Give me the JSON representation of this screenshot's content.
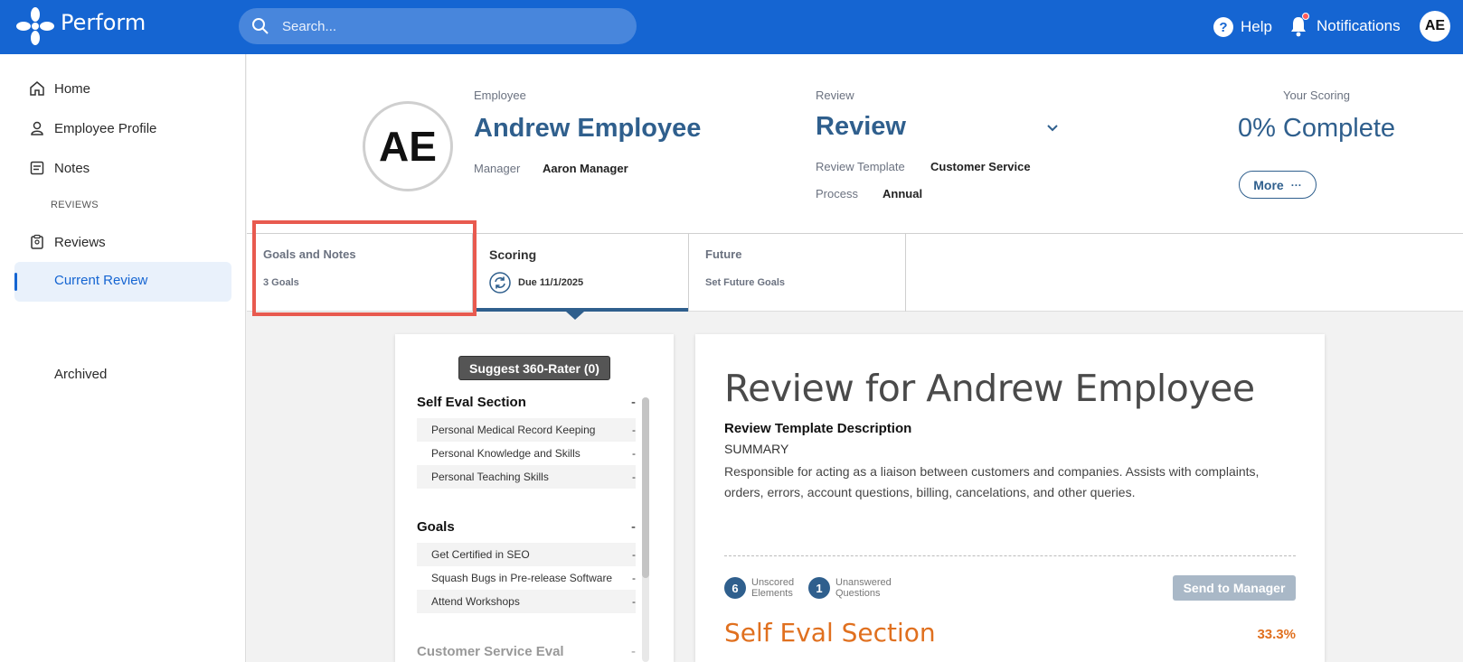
{
  "app": {
    "brand": "Perform",
    "search_placeholder": "Search...",
    "help_label": "Help",
    "notifications_label": "Notifications",
    "user_initials": "AE"
  },
  "sidebar": {
    "home": "Home",
    "employee_profile": "Employee Profile",
    "notes": "Notes",
    "section_label": "REVIEWS",
    "reviews": "Reviews",
    "current_review": "Current Review",
    "archived": "Archived"
  },
  "header": {
    "avatar_initials": "AE",
    "employee_label": "Employee",
    "employee_name": "Andrew Employee",
    "manager_label": "Manager",
    "manager_name": "Aaron Manager",
    "review_label": "Review",
    "review_title": "Review",
    "template_label": "Review Template",
    "template_value": "Customer Service",
    "process_label": "Process",
    "process_value": "Annual",
    "scoring_label": "Your Scoring",
    "scoring_value": "0% Complete",
    "more_label": "More",
    "more_dots": "···"
  },
  "tabs": [
    {
      "title": "Goals and Notes",
      "subtitle": "3 Goals"
    },
    {
      "title": "Scoring",
      "subtitle": "Due 11/1/2025"
    },
    {
      "title": "Future",
      "subtitle": "Set Future Goals"
    }
  ],
  "outline": {
    "suggest_button": "Suggest 360-Rater (0)",
    "dash": "-",
    "sections": [
      {
        "title": "Self Eval Section",
        "items": [
          "Personal Medical Record Keeping",
          "Personal Knowledge and Skills",
          "Personal Teaching Skills"
        ]
      },
      {
        "title": "Goals",
        "items": [
          "Get Certified in SEO",
          "Squash Bugs in Pre-release Software",
          "Attend Workshops"
        ]
      },
      {
        "title": "Customer Service Eval",
        "items": []
      }
    ]
  },
  "main": {
    "heading": "Review for Andrew Employee",
    "description_heading": "Review Template Description",
    "summary_label": "SUMMARY",
    "description": "Responsible for acting as a liaison between customers and companies. Assists with complaints, orders, errors, account questions, billing, cancelations, and other queries.",
    "unscored_count": "6",
    "unscored_label_1": "Unscored",
    "unscored_label_2": "Elements",
    "unanswered_count": "1",
    "unanswered_label_1": "Unanswered",
    "unanswered_label_2": "Questions",
    "send_button": "Send to Manager",
    "section_title": "Self Eval Section",
    "section_percent": "33.3%"
  },
  "colors": {
    "topbar": "#1565d2",
    "accent": "#2f5f8d",
    "orange": "#e0701f",
    "highlight": "#e85a4f"
  }
}
